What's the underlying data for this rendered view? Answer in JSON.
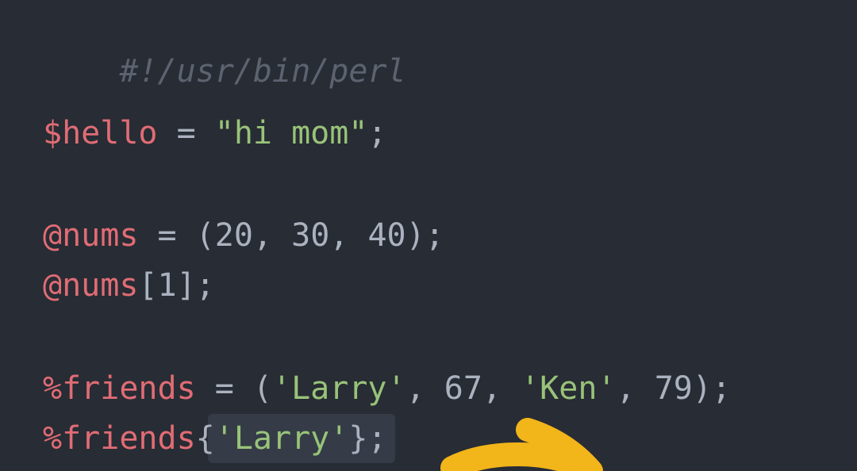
{
  "code": {
    "shebang": "#!/usr/bin/perl",
    "line_hello": {
      "var": "$hello",
      "op": " = ",
      "str": "\"hi mom\"",
      "end": ";"
    },
    "line_nums_assign": {
      "var": "@nums",
      "op": " = ",
      "open": "(",
      "n1": "20",
      "sep1": ", ",
      "n2": "30",
      "sep2": ", ",
      "n3": "40",
      "close": ");"
    },
    "line_nums_index": {
      "var": "@nums",
      "rest": "[1];"
    },
    "line_friends_assign": {
      "var": "%friends",
      "op": " = ",
      "open": "(",
      "s1": "'Larry'",
      "sep1": ", ",
      "n1": "67",
      "sep2": ", ",
      "s2": "'Ken'",
      "sep3": ", ",
      "n2": "79",
      "close": ");"
    },
    "line_friends_lookup": {
      "var": "%friends",
      "open": "{",
      "key": "'Larry'",
      "close": "}",
      "end": ";"
    }
  },
  "colors": {
    "background": "#282c34",
    "variable": "#e06c75",
    "string": "#98c379",
    "comment": "#5c6370",
    "plain": "#abb2bf",
    "arrow": "#f2b51a"
  },
  "icons": {
    "pointer": "arrow-pointer-icon"
  }
}
